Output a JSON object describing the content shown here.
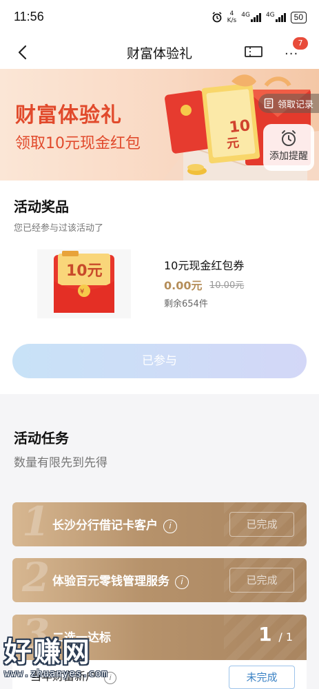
{
  "status_bar": {
    "time": "11:56",
    "speed_value": "4",
    "speed_unit": "K/s",
    "net1": "4G",
    "net2": "4G",
    "battery": "50"
  },
  "nav": {
    "title": "财富体验礼",
    "badge_count": "7"
  },
  "banner": {
    "title": "财富体验礼",
    "subtitle": "领取10元现金红包",
    "records_label": "领取记录",
    "remind_label": "添加提醒",
    "art_amount": "10",
    "art_unit": "元"
  },
  "prize": {
    "section_title": "活动奖品",
    "section_subtitle": "您已经参与过该活动了",
    "image_amount": "10元",
    "name": "10元现金红包券",
    "price": "0.00元",
    "original_price": "10.00元",
    "stock": "剩余654件",
    "button_label": "已参与"
  },
  "tasks": {
    "section_title": "活动任务",
    "section_subtitle": "数量有限先到先得",
    "items": [
      {
        "num": "1",
        "name": "长沙分行借记卡客户",
        "status": "已完成"
      },
      {
        "num": "2",
        "name": "体验百元零钱管理服务",
        "status": "已完成"
      },
      {
        "num": "3",
        "name": "二选一达标",
        "progress_done": "1",
        "progress_total": "/ 1"
      }
    ],
    "sub_item": {
      "name": "当年财富新户",
      "status": "未完成"
    }
  },
  "watermark": {
    "text": "好赚网",
    "url": "www.zhuanyes.com"
  },
  "colors": {
    "accent_red": "#e14a2c",
    "gold": "#b58e5a",
    "task_brown": "#b6926b",
    "link_blue": "#3b82c4"
  }
}
